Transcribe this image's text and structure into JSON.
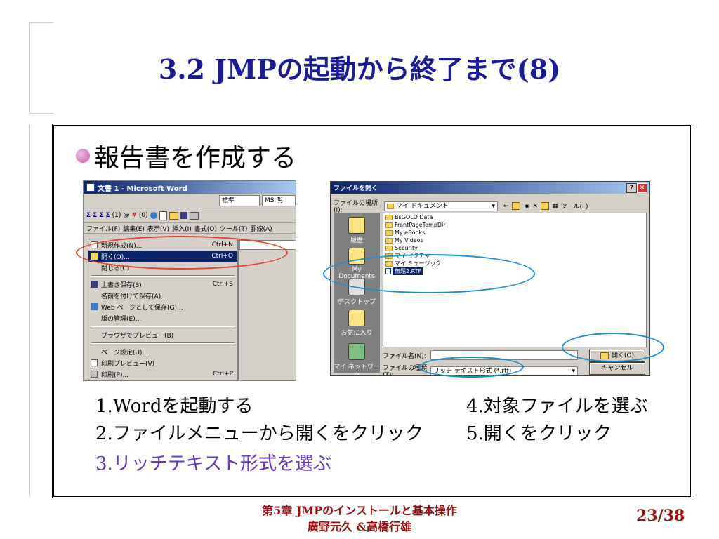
{
  "slide": {
    "title": "3.2 JMPの起動から終了まで(8)",
    "bullet": "報告書を作成する",
    "steps": [
      "1.Wordを起動する",
      "4.対象ファイルを選ぶ",
      "2.ファイルメニューから開くをクリック",
      "5.開くをクリック",
      "3.リッチテキスト形式を選ぶ"
    ],
    "footer_line1": "第5章 JMPのインストールと基本操作",
    "footer_line2": "廣野元久 &高橋行雄",
    "page_number": "23/38"
  },
  "word": {
    "title": "文書 1 - Microsoft Word",
    "style_combo": "標準",
    "font_combo": "MS 明",
    "toolbar_glyphs": [
      "Σ",
      "Σ",
      "Σ",
      "Σ",
      "(1)",
      "@",
      "#",
      "(0)"
    ],
    "menubar": [
      "ファイル(F)",
      "編集(E)",
      "表示(V)",
      "挿入(I)",
      "書式(O)",
      "ツール(T)",
      "罫線(A)"
    ],
    "menu_items": [
      {
        "label": "新規作成(N)...",
        "shortcut": "Ctrl+N"
      },
      {
        "label": "開く(O)...",
        "shortcut": "Ctrl+O"
      },
      {
        "label": "閉じる(C)",
        "shortcut": ""
      },
      {
        "label": "上書き保存(S)",
        "shortcut": "Ctrl+S"
      },
      {
        "label": "名前を付けて保存(A)...",
        "shortcut": ""
      },
      {
        "label": "Web ページとして保存(G)...",
        "shortcut": ""
      },
      {
        "label": "版の管理(E)...",
        "shortcut": ""
      },
      {
        "label": "ブラウザでプレビュー(B)",
        "shortcut": ""
      },
      {
        "label": "ページ設定(U)...",
        "shortcut": ""
      },
      {
        "label": "印刷プレビュー(V)",
        "shortcut": ""
      },
      {
        "label": "印刷(P)...",
        "shortcut": "Ctrl+P"
      }
    ]
  },
  "dialog": {
    "title": "ファイルを開く",
    "location_label": "ファイルの場所(I):",
    "location_value": "マイ ドキュメント",
    "tools_label": "ツール(L)",
    "places": [
      "履歴",
      "My Documents",
      "デスクトップ",
      "お気に入り",
      "マイ ネットワーク"
    ],
    "files": [
      "BsGOLD Data",
      "FrontPageTempDir",
      "My eBooks",
      "My Videos",
      "Security",
      "マイ ピクチャ",
      "マイ ミュージック",
      "無題2.RTF"
    ],
    "filename_label": "ファイル名(N):",
    "filename_value": "",
    "filetype_label": "ファイルの種類(T):",
    "filetype_value": "リッチ テキスト形式 (*.rtf)",
    "open_button": "開く(O)",
    "cancel_button": "キャンセル"
  },
  "colors": {
    "title": "#1a1a9a",
    "footer": "#9a0f0f",
    "highlight_step": "#6633cc",
    "red_ellipse": "#e8402a",
    "blue_ellipse": "#1a8fcf"
  }
}
